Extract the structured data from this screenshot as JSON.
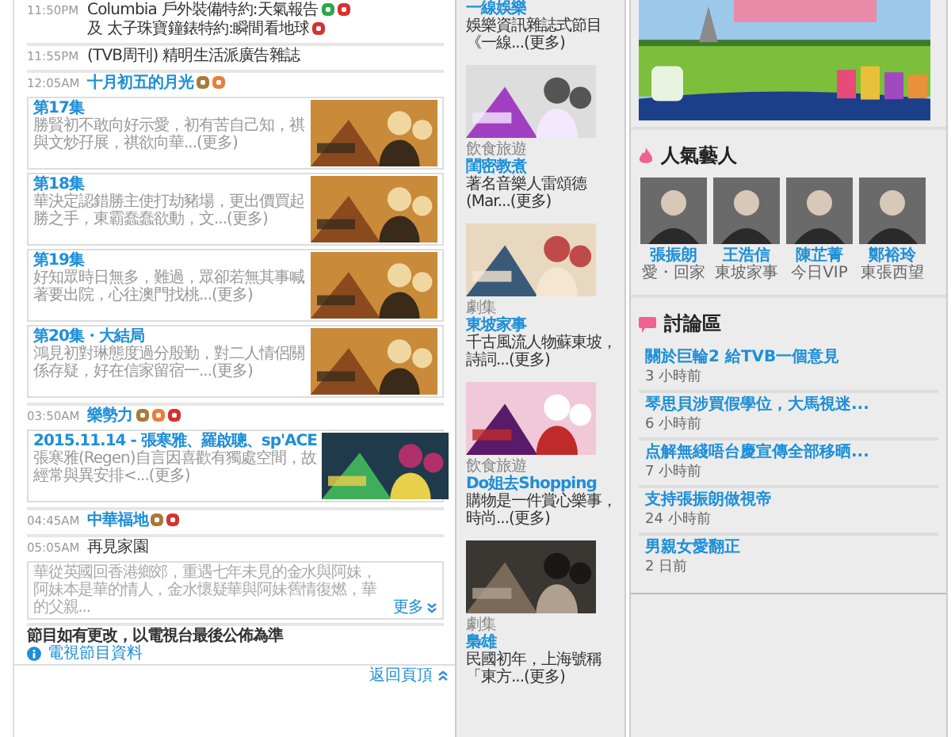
{
  "schedule": [
    {
      "time": "11:50PM",
      "linked": false,
      "parts": [
        {
          "text": "Columbia 戶外裝備特約:天氣報告",
          "badges": [
            {
              "kind": "caption"
            },
            {
              "kind": "hd"
            }
          ]
        },
        {
          "text": "及 太子珠寶鐘錶特約:瞬間看地球",
          "badges": [
            {
              "kind": "hd"
            }
          ]
        }
      ]
    },
    {
      "time": "11:55PM",
      "linked": false,
      "parts": [
        {
          "text": "(TVB周刊) 精明生活派廣告雜誌"
        }
      ]
    },
    {
      "time": "12:05AM",
      "linked": true,
      "parts": [
        {
          "text": "十月初五的月光",
          "badges": [
            {
              "kind": "stereo"
            },
            {
              "kind": "repeat"
            }
          ]
        }
      ],
      "episodes": [
        {
          "title": "第17集",
          "summary": "勝賢初不敢向好示愛，初有苦自己知，祺與文炒孖展，祺欲向華...(更多)"
        },
        {
          "title": "第18集",
          "summary": "華決定認錯勝主使打劫豬場，更出價買起勝之手，東霸蠢蠢欲動，文...(更多)"
        },
        {
          "title": "第19集",
          "summary": "好知眾時日無多，難過，眾卻若無其事喊著要出院，心往澳門找桃...(更多)"
        },
        {
          "title": "第20集・大結局",
          "summary": "鴻見初對琳態度過分殷勤，對二人情侶關係存疑，好在信家留宿一...(更多)"
        }
      ]
    },
    {
      "time": "03:50AM",
      "linked": true,
      "parts": [
        {
          "text": "樂勢力",
          "badges": [
            {
              "kind": "stereo"
            },
            {
              "kind": "repeat"
            },
            {
              "kind": "hd"
            }
          ]
        }
      ],
      "episodes": [
        {
          "title": "2015.11.14 - 張寒雅、羅啟聰、sp'ACE",
          "summary": "張寒雅(Regen)自言因喜歡有獨處空間，故經常與異安排<...(更多)"
        }
      ]
    },
    {
      "time": "04:45AM",
      "linked": true,
      "parts": [
        {
          "text": "中華福地",
          "badges": [
            {
              "kind": "stereo"
            },
            {
              "kind": "hd"
            }
          ]
        }
      ]
    },
    {
      "time": "05:05AM",
      "linked": false,
      "parts": [
        {
          "text": "再見家園"
        }
      ],
      "synopsis": {
        "text": "華從英國回香港鄉郊，重遇七年未見的金水與阿妹，阿妹本是華的情人，金水懷疑華與阿妹舊情復燃，華的父親...",
        "more": "更多"
      }
    }
  ],
  "notice": "節目如有更改，以電視台最後公佈為準",
  "info_link": "電視節目資料",
  "back_to_top": "返回頁頂",
  "features": [
    {
      "title": "一線娛樂",
      "summary": "娛樂資訊雜誌式節目《一線...(更多)"
    },
    {
      "category": "飲食旅遊",
      "title": "閨密教煮",
      "summary": "著名音樂人雷頌德(Mar...(更多)"
    },
    {
      "category": "劇集",
      "title": "東坡家事",
      "summary": "千古風流人物蘇東坡，詩詞...(更多)"
    },
    {
      "category": "飲食旅遊",
      "title": "Do姐去Shopping",
      "summary": "購物是一件賞心樂事，時尚...(更多)"
    },
    {
      "category": "劇集",
      "title": "梟雄",
      "summary": "民國初年，上海號稱「東方...(更多)"
    }
  ],
  "artists": {
    "title": "人氣藝人",
    "items": [
      {
        "name": "張振朗",
        "show": "愛・回家"
      },
      {
        "name": "王浩信",
        "show": "東坡家事"
      },
      {
        "name": "陳芷菁",
        "show": "今日VIP"
      },
      {
        "name": "鄭裕玲",
        "show": "東張西望"
      }
    ]
  },
  "forum": {
    "title": "討論區",
    "posts": [
      {
        "title": "關於巨輪2 給TVB一個意見",
        "age": "3 小時前"
      },
      {
        "title": "琴思貝涉買假學位，大馬視迷...",
        "age": "6 小時前"
      },
      {
        "title": "点解無綫唔台慶宣傳全部移晒...",
        "age": "7 小時前"
      },
      {
        "title": "支持張振朗做視帝",
        "age": "24 小時前"
      },
      {
        "title": "男親女愛翻正",
        "age": "2 日前"
      }
    ]
  }
}
